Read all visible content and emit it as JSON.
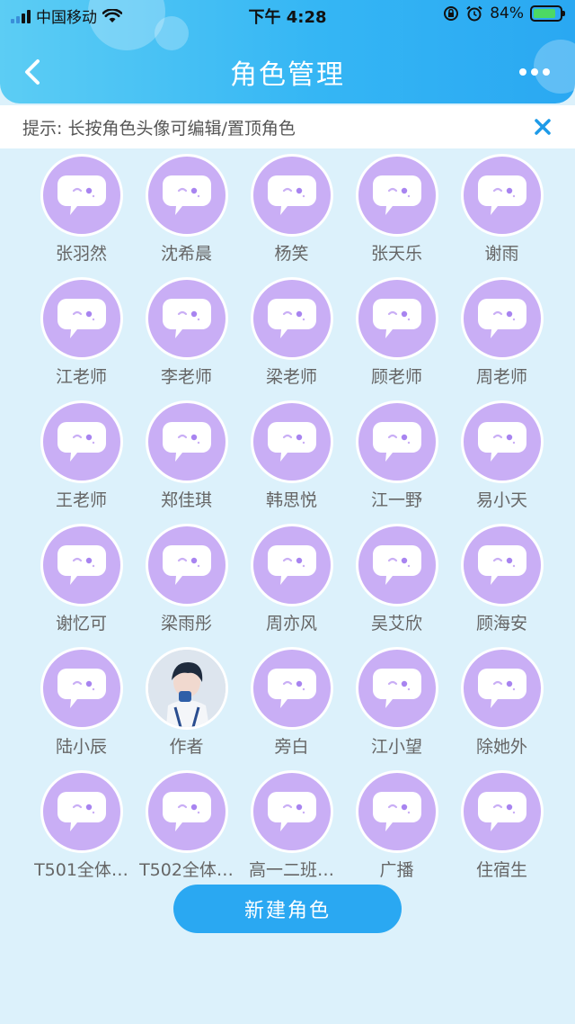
{
  "status_bar": {
    "carrier": "中国移动",
    "time": "下午 4:28",
    "battery": "84%"
  },
  "header": {
    "title": "角色管理"
  },
  "tip": {
    "text": "提示: 长按角色头像可编辑/置顶角色"
  },
  "roles": [
    {
      "name": "张羽然",
      "avatar": "chat-bubble-icon"
    },
    {
      "name": "沈希晨",
      "avatar": "chat-bubble-icon"
    },
    {
      "name": "杨笑",
      "avatar": "chat-bubble-icon"
    },
    {
      "name": "张天乐",
      "avatar": "chat-bubble-icon"
    },
    {
      "name": "谢雨",
      "avatar": "chat-bubble-icon"
    },
    {
      "name": "江老师",
      "avatar": "chat-bubble-icon"
    },
    {
      "name": "李老师",
      "avatar": "chat-bubble-icon"
    },
    {
      "name": "梁老师",
      "avatar": "chat-bubble-icon"
    },
    {
      "name": "顾老师",
      "avatar": "chat-bubble-icon"
    },
    {
      "name": "周老师",
      "avatar": "chat-bubble-icon"
    },
    {
      "name": "王老师",
      "avatar": "chat-bubble-icon"
    },
    {
      "name": "郑佳琪",
      "avatar": "chat-bubble-icon"
    },
    {
      "name": "韩思悦",
      "avatar": "chat-bubble-icon"
    },
    {
      "name": "江一野",
      "avatar": "chat-bubble-icon"
    },
    {
      "name": "易小天",
      "avatar": "chat-bubble-icon"
    },
    {
      "name": "谢忆可",
      "avatar": "chat-bubble-icon"
    },
    {
      "name": "梁雨彤",
      "avatar": "chat-bubble-icon"
    },
    {
      "name": "周亦风",
      "avatar": "chat-bubble-icon"
    },
    {
      "name": "吴艾欣",
      "avatar": "chat-bubble-icon"
    },
    {
      "name": "顾海安",
      "avatar": "chat-bubble-icon"
    },
    {
      "name": "陆小辰",
      "avatar": "chat-bubble-icon"
    },
    {
      "name": "作者",
      "avatar": "photo"
    },
    {
      "name": "旁白",
      "avatar": "chat-bubble-icon"
    },
    {
      "name": "江小望",
      "avatar": "chat-bubble-icon"
    },
    {
      "name": "除她外",
      "avatar": "chat-bubble-icon"
    },
    {
      "name": "T501全体…",
      "avatar": "chat-bubble-icon"
    },
    {
      "name": "T502全体…",
      "avatar": "chat-bubble-icon"
    },
    {
      "name": "高一二班…",
      "avatar": "chat-bubble-icon"
    },
    {
      "name": "广播",
      "avatar": "chat-bubble-icon"
    },
    {
      "name": "住宿生",
      "avatar": "chat-bubble-icon"
    }
  ],
  "actions": {
    "new_role_label": "新建角色"
  },
  "colors": {
    "header_gradient_start": "#5ccdf4",
    "header_gradient_end": "#2aa8f2",
    "page_background": "#dcf1fb",
    "avatar_purple": "#c9aef5",
    "accent_blue": "#2aa8f2"
  }
}
